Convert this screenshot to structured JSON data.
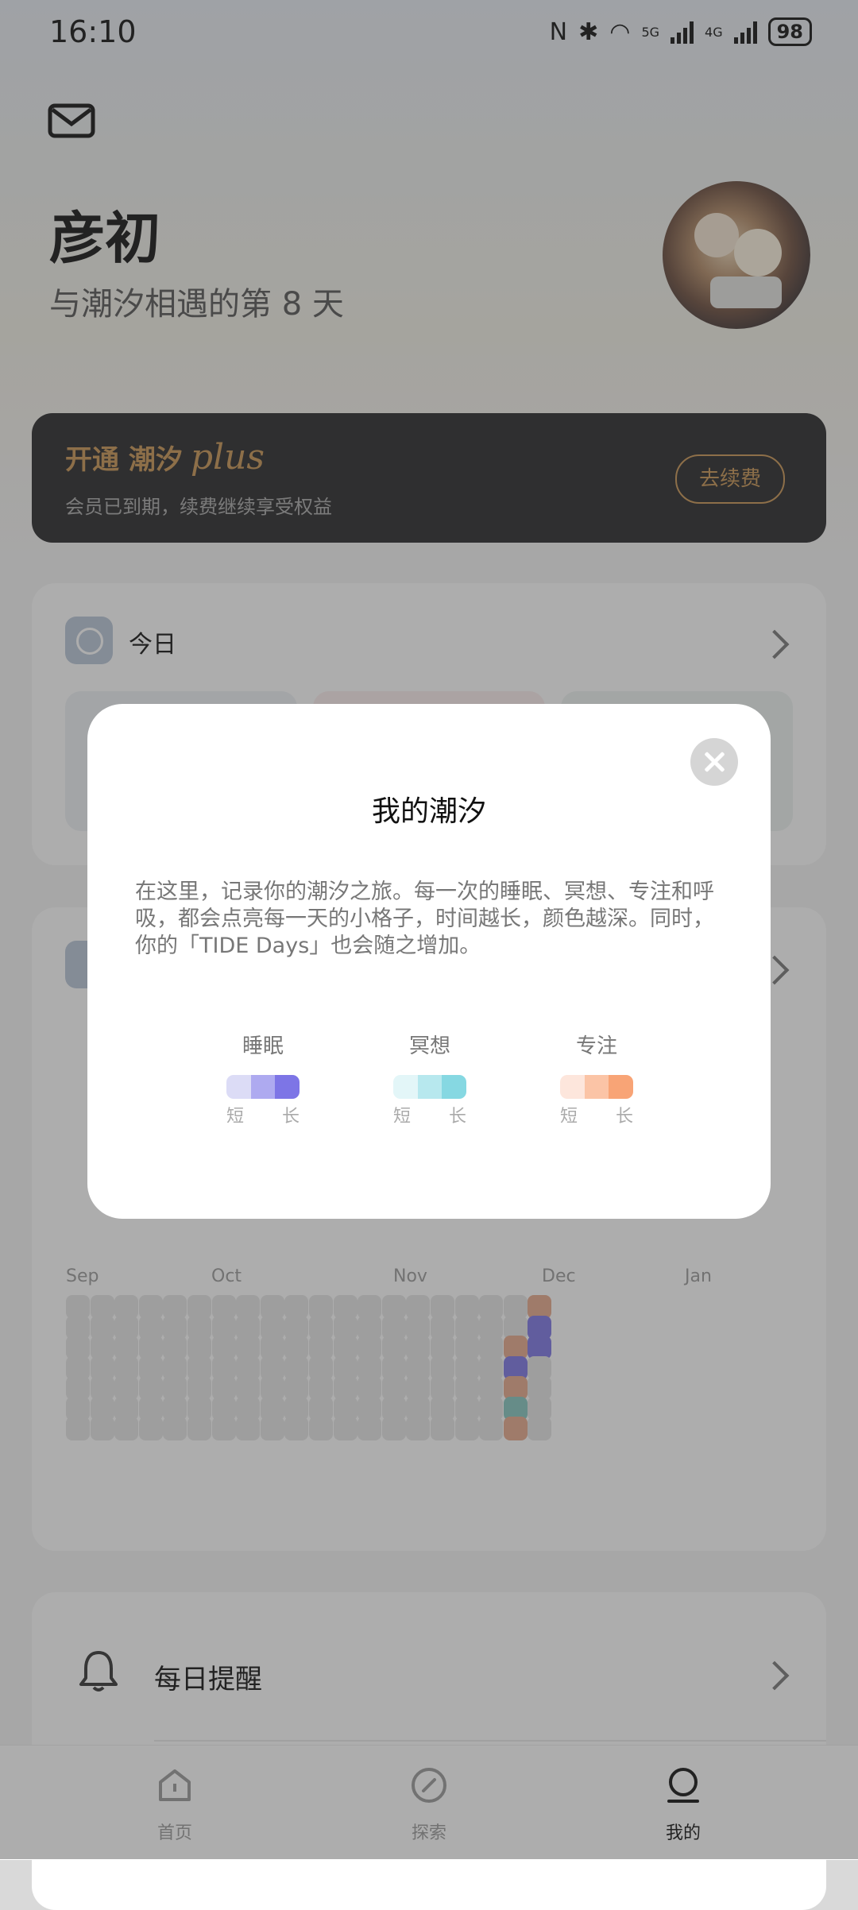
{
  "status_bar": {
    "time": "16:10",
    "network_5g": "5G",
    "network_4g": "4G",
    "battery": "98"
  },
  "profile": {
    "name": "彦初",
    "subtitle": "与潮汐相遇的第 8 天"
  },
  "plus_card": {
    "title_prefix": "开通 潮汐",
    "title_script": "plus",
    "subtitle": "会员已到期，续费继续享受权益",
    "button": "去续费",
    "accent_color": "#c89553"
  },
  "today_card": {
    "label": "今日"
  },
  "days_card": {
    "months": [
      "Sep",
      "Oct",
      "Nov",
      "Dec",
      "Jan"
    ]
  },
  "reminder": {
    "label": "每日提醒"
  },
  "tabs": [
    {
      "label": "首页",
      "icon": "home-icon"
    },
    {
      "label": "探索",
      "icon": "compass-icon"
    },
    {
      "label": "我的",
      "icon": "profile-icon"
    }
  ],
  "modal": {
    "title": "我的潮汐",
    "body": "在这里，记录你的潮汐之旅。每一次的睡眠、冥想、专注和呼吸，都会点亮每一天的小格子，时间越长，颜色越深。同时，你的「TIDE Days」也会随之增加。",
    "legend": [
      {
        "label": "睡眠",
        "short": "短",
        "long": "长",
        "colors": [
          "#dcdcf6",
          "#aeaaf0",
          "#7d75e6"
        ]
      },
      {
        "label": "冥想",
        "short": "短",
        "long": "长",
        "colors": [
          "#e3f6f8",
          "#b7e8ee",
          "#86d8e2"
        ]
      },
      {
        "label": "专注",
        "short": "短",
        "long": "长",
        "colors": [
          "#fde6dc",
          "#fbc4a6",
          "#f8a476"
        ]
      }
    ]
  }
}
